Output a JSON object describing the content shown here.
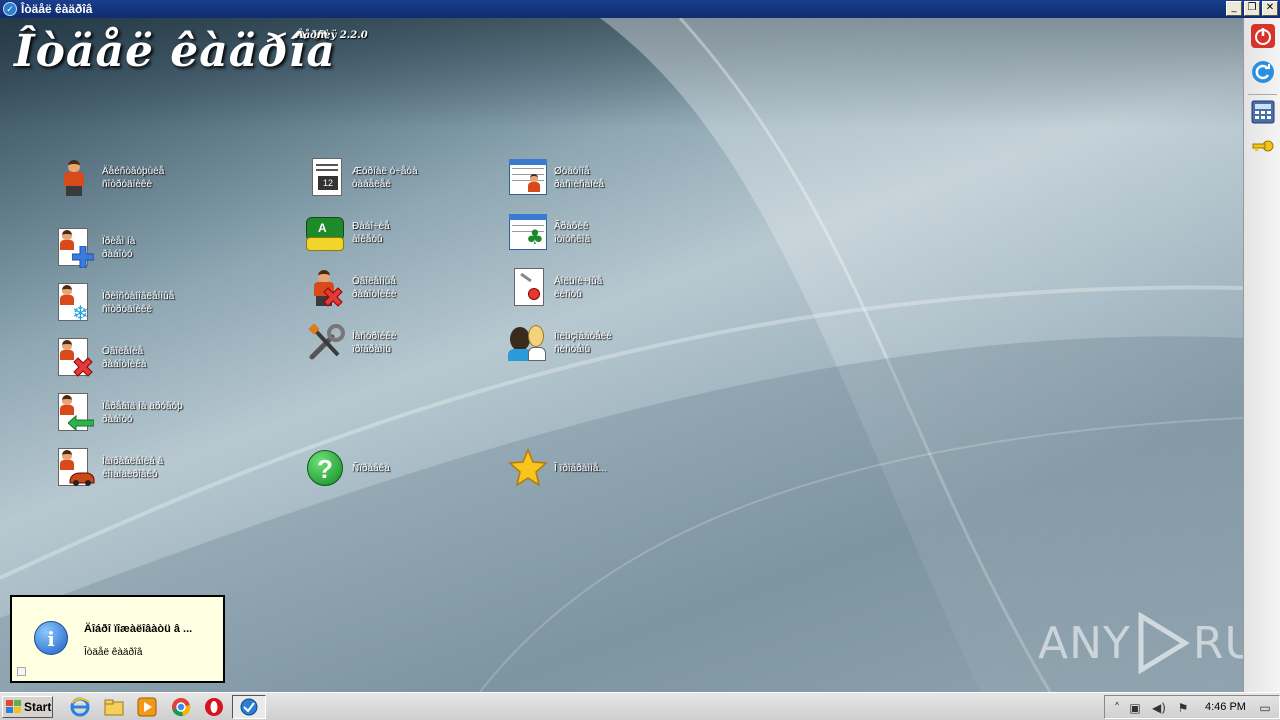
{
  "window": {
    "title": "Îòäåë êàäðîâ",
    "minimize": "_",
    "restore": "❐",
    "close": "✕"
  },
  "header": {
    "app_title": "Îòäåë êàäðîâ",
    "version": "Âåðñèÿ 2.2.0"
  },
  "menu": {
    "col1": [
      {
        "id": "employees",
        "label": "Äåéñòâóþùèå\nñîòðóäíèêè",
        "icon": "person-icon"
      },
      {
        "id": "hire",
        "label": "Ïðèåì íà\nðàáîòó",
        "icon": "person-add-icon"
      },
      {
        "id": "suspended",
        "label": "Ïðèîñòàíîâëåííûå\nñîòðóäíèêè",
        "icon": "person-frozen-icon"
      },
      {
        "id": "dismiss",
        "label": "Óâîëåíèå\nðàáîòíèêà",
        "icon": "person-remove-icon"
      },
      {
        "id": "transfer",
        "label": "Ïåðåâîä íà äðóãóþ\nðàáîòó",
        "icon": "person-transfer-icon"
      },
      {
        "id": "business_trip",
        "label": "Íàïðàâëåíèå â\nêîìàíäèðîâêó",
        "icon": "person-trip-icon"
      }
    ],
    "col2": [
      {
        "id": "journal",
        "label": "Æóðíàë ó÷åòà\nòàáåëåé",
        "icon": "journal-icon"
      },
      {
        "id": "reports",
        "label": "Ðàáî÷èå\nàíêåòû",
        "icon": "reports-icon"
      },
      {
        "id": "fired",
        "label": "Óâîëåííûå\nðàáîòíèêè",
        "icon": "person-fired-icon"
      },
      {
        "id": "settings",
        "label": "Íàñòðîéêè\nïðîãðàììû",
        "icon": "tools-icon"
      },
      {
        "id": "help",
        "label": "Ñïðàâêà",
        "icon": "help-icon"
      }
    ],
    "col3": [
      {
        "id": "schedule",
        "label": "Øòàòíîå\nðàñïèñàíèå",
        "icon": "schedule-icon"
      },
      {
        "id": "vacations",
        "label": "Ãðàôèê\nîòïóñêîâ",
        "icon": "vacation-icon"
      },
      {
        "id": "sick_leave",
        "label": "Áîëüíè÷íûå\nëèñòû",
        "icon": "sick-leave-icon"
      },
      {
        "id": "users",
        "label": "Ïîëüçîâàòåëè\nñèñòåìû",
        "icon": "users-icon"
      },
      {
        "id": "about",
        "label": "Î ïðîãðàììå...",
        "icon": "star-icon"
      }
    ]
  },
  "info_panel": {
    "title": "Äîáðî ïîæàëîâàòü â ...",
    "subtitle": "Îòäåë êàäðîâ"
  },
  "watermark": {
    "left": "ANY",
    "right": "RUN"
  },
  "taskbar": {
    "start_label": "Start",
    "clock": "4:46 PM",
    "tray_up": "˄"
  },
  "colors": {
    "title_bar": "#0f2d6e",
    "label_text": "#ffffff",
    "info_bg": "#ffffe1"
  }
}
